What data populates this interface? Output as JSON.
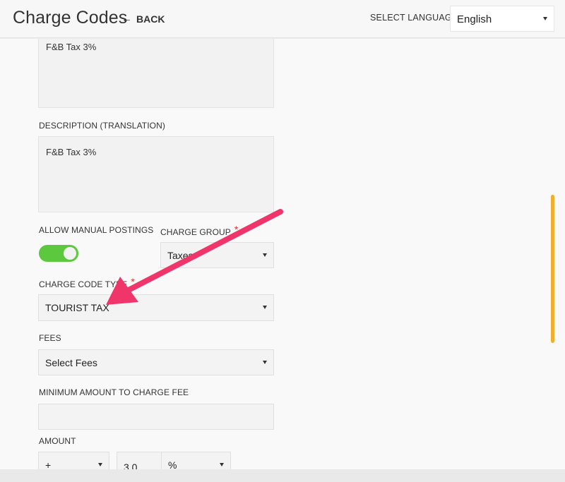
{
  "header": {
    "title": "Charge Codes",
    "back_label": "BACK",
    "back_arrow": "←",
    "language_label": "SELECT LANGUAGE",
    "language_value": "English"
  },
  "form": {
    "description_value": "F&B Tax 3%",
    "description_translation_label": "DESCRIPTION (TRANSLATION)",
    "description_translation_value": "F&B Tax 3%",
    "allow_manual_postings_label": "ALLOW MANUAL POSTINGS",
    "allow_manual_postings_on": true,
    "charge_group_label": "CHARGE GROUP",
    "charge_group_value": "Taxes",
    "charge_code_type_label": "CHARGE CODE TYPE",
    "charge_code_type_value": "TOURIST TAX",
    "fees_label": "FEES",
    "fees_value": "Select Fees",
    "minimum_amount_label": "MINIMUM AMOUNT TO CHARGE FEE",
    "minimum_amount_value": "",
    "amount_label": "AMOUNT",
    "amount_sign_value": "+",
    "amount_value": "3.0",
    "amount_unit_value": "%",
    "required_marker": "*"
  },
  "colors": {
    "toggle_on": "#5cc83e",
    "required": "#e0302e",
    "annotation_arrow": "#f0356b",
    "scrollbar": "#f0b02c"
  }
}
